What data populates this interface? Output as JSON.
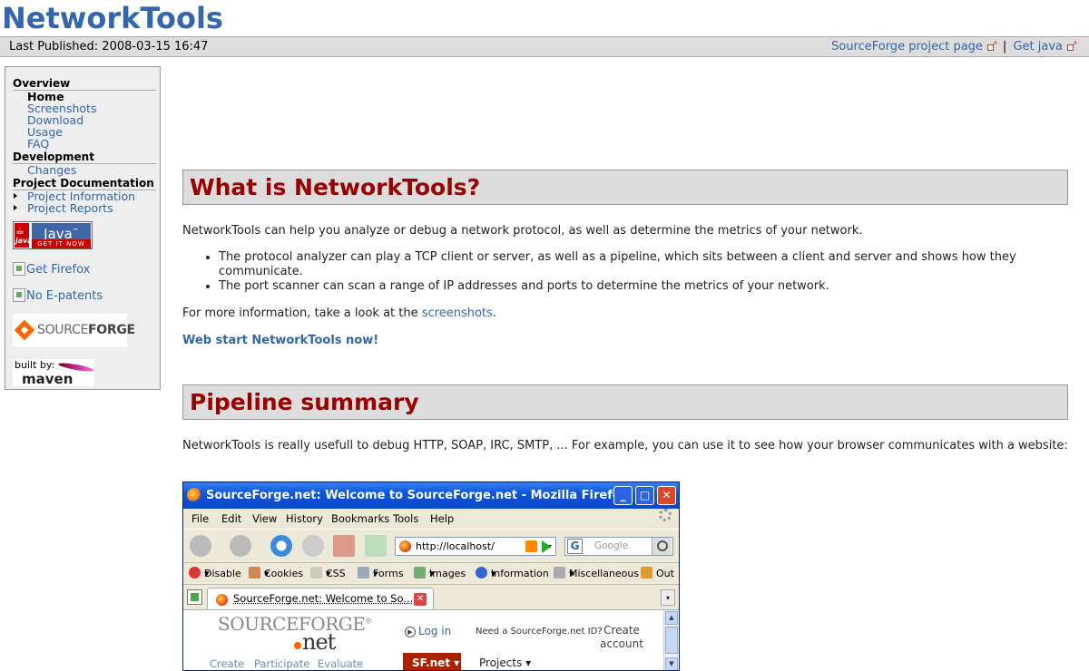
{
  "header": {
    "title": "NetworkTools"
  },
  "breadcrumbs": {
    "last_published": "Last Published: 2008-03-15 16:47",
    "sourceforge_link": "SourceForge project page",
    "separator": "|",
    "java_link": "Get java"
  },
  "sidebar": {
    "overview": {
      "heading": "Overview",
      "items": [
        "Home",
        "Screenshots",
        "Download",
        "Usage",
        "FAQ"
      ]
    },
    "development": {
      "heading": "Development",
      "items": [
        "Changes"
      ]
    },
    "project_documentation": {
      "heading": "Project Documentation",
      "items": [
        "Project Information",
        "Project Reports"
      ]
    },
    "badges": {
      "java_main": "Java",
      "java_tm": "™",
      "java_small": "java",
      "java_get": "GET IT NOW",
      "firefox_alt": "Get Firefox",
      "epatents_alt": "No E-patents",
      "sourceforge_a": "SOURCE",
      "sourceforge_b": "FORGE",
      "maven_built": "built by:",
      "maven": "maven"
    }
  },
  "main": {
    "section1": {
      "heading": "What is NetworkTools?",
      "intro": "NetworkTools can help you analyze or debug a network protocol, as well as determine the metrics of your network.",
      "bullets": [
        "The protocol analyzer can play a TCP client or server, as well as a pipeline, which sits between a client and server and shows how they communicate.",
        "The port scanner can scan a range of IP addresses and ports to determine the metrics of your network."
      ],
      "more_prefix": "For more information, take a look at the ",
      "more_link": "screenshots",
      "more_suffix": ".",
      "webstart": "Web start NetworkTools now!"
    },
    "section2": {
      "heading": "Pipeline summary",
      "text": "NetworkTools is really usefull to debug HTTP, SOAP, IRC, SMTP, ... For example, you can use it to see how your browser communicates with a website:"
    }
  },
  "screenshot": {
    "window_title": "SourceForge.net: Welcome to SourceForge.net - Mozilla Firefox",
    "window_buttons": {
      "min": "_",
      "max": "□",
      "close": "✕"
    },
    "menu": [
      "File",
      "Edit",
      "View",
      "History",
      "Bookmarks",
      "Tools",
      "Help"
    ],
    "url": "http://localhost/",
    "url_dropdown": "▾",
    "search_placeholder": "Google",
    "search_engine": "G",
    "webdev_toolbar": [
      "Disable",
      "Cookies",
      "CSS",
      "Forms",
      "Images",
      "Information",
      "Miscellaneous",
      "Out"
    ],
    "tab_label": "SourceForge.net: Welcome to So...",
    "tab_close": "✕",
    "tab_menu": "▾",
    "page": {
      "logo_top": "SOURCEFORGE",
      "logo_reg": "®",
      "logo_bottom": "net",
      "nav": [
        "Create",
        "Participate",
        "Evaluate"
      ],
      "login_arrow": "▶",
      "login": "Log in",
      "need_id": "Need a SourceForge.net ID?",
      "create_account": "Create account",
      "sfnet": "SF.net",
      "sfnet_arrow": "▾",
      "projects": "Projects",
      "projects_arrow": "▾",
      "scroll_up": "▲",
      "scroll_down": "▼"
    }
  },
  "colors": {
    "link": "#3366aa",
    "heading_red": "#990000",
    "bar_gray": "#dddddd",
    "xp_blue": "#0b56dc"
  }
}
